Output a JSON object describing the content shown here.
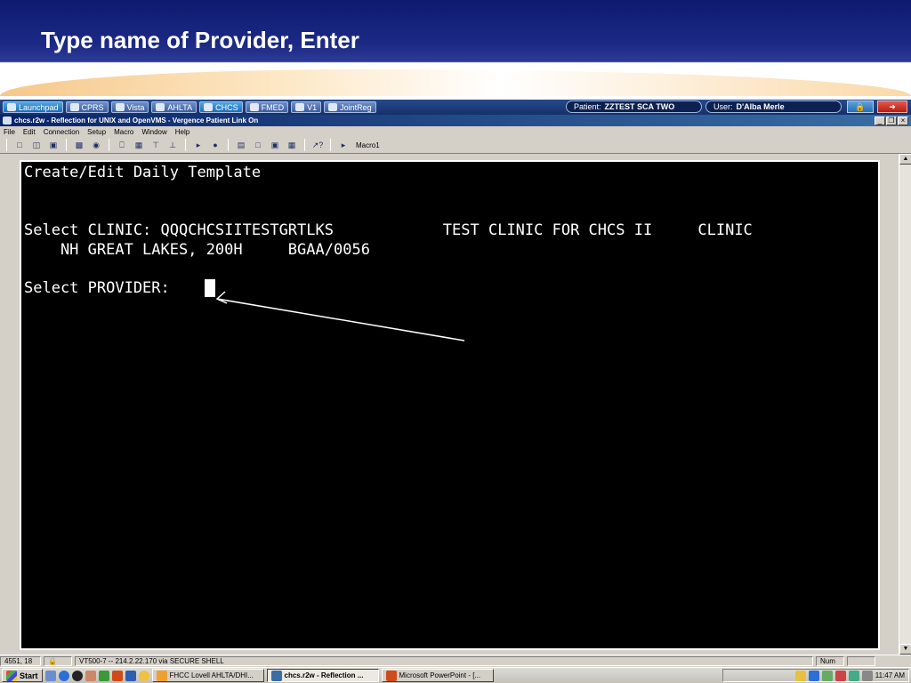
{
  "slide": {
    "title": "Type name of Provider, Enter"
  },
  "launchbar": {
    "buttons": [
      {
        "label": "Launchpad"
      },
      {
        "label": "CPRS"
      },
      {
        "label": "Vista"
      },
      {
        "label": "AHLTA"
      },
      {
        "label": "CHCS"
      },
      {
        "label": "FMED"
      },
      {
        "label": "V1"
      },
      {
        "label": "JointReg"
      }
    ],
    "patient_key": "Patient:",
    "patient_value": "ZZTEST SCA TWO",
    "user_key": "User:",
    "user_value": "D'Alba Merle"
  },
  "window": {
    "title": "chcs.r2w - Reflection for UNIX and OpenVMS - Vergence Patient Link On",
    "menu": [
      "File",
      "Edit",
      "Connection",
      "Setup",
      "Macro",
      "Window",
      "Help"
    ],
    "macro_label": "Macro1"
  },
  "terminal": {
    "lines": [
      "Create/Edit Daily Template",
      "",
      "",
      "Select CLINIC: QQQCHCSIITESTGRTLKS            TEST CLINIC FOR CHCS II     CLINIC",
      "    NH GREAT LAKES, 200H     BGAA/0056",
      "",
      "Select PROVIDER:"
    ],
    "background": "#000000",
    "foreground": "#ffffff"
  },
  "statusbar": {
    "position": "4551, 18",
    "session": "VT500-7 -- 214.2.22.170 via SECURE SHELL",
    "num": "Num"
  },
  "taskbar": {
    "start": "Start",
    "tasks": [
      {
        "label": "FHCC Lovell AHLTA/DHI...",
        "active": false
      },
      {
        "label": "chcs.r2w - Reflection ...",
        "active": true
      },
      {
        "label": "Microsoft PowerPoint - [...",
        "active": false
      }
    ],
    "clock": "11:47 AM"
  },
  "colors": {
    "slide_bg": "#1c2a86",
    "titlebar": "#0a246a",
    "terminal": "#000000"
  }
}
